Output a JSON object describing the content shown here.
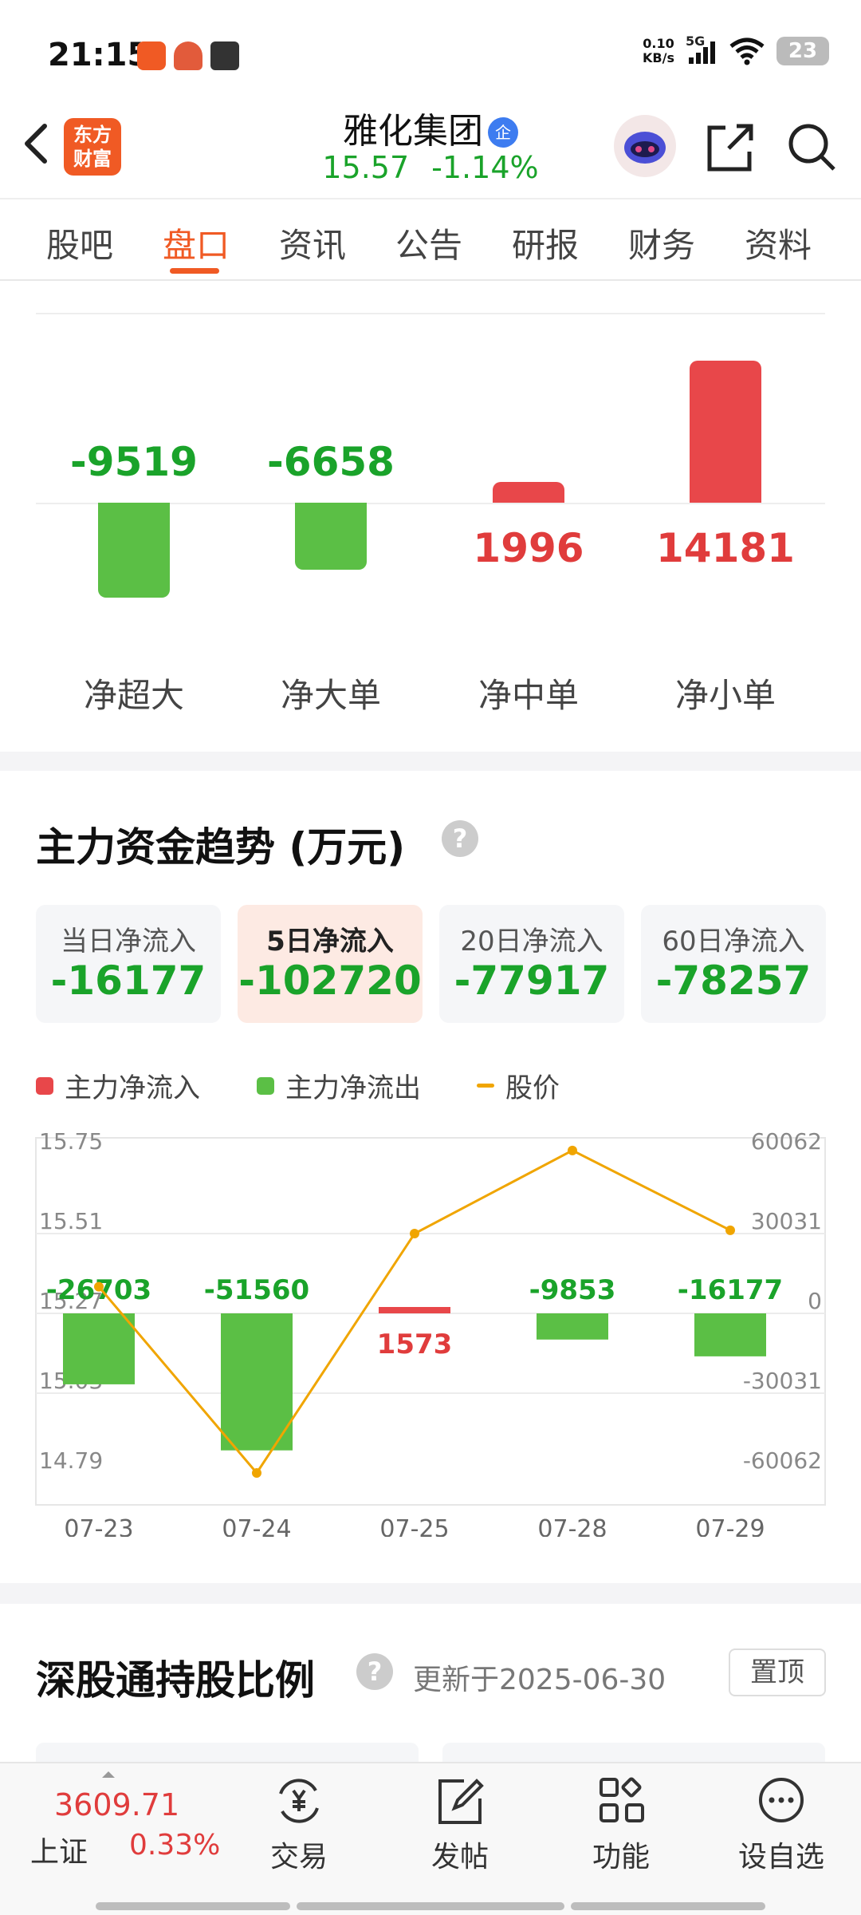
{
  "status_bar": {
    "time": "21:15",
    "net_speed_value": "0.10",
    "net_speed_unit": "KB/s",
    "signal": "5G",
    "battery": "23"
  },
  "header": {
    "logo_line1": "东方",
    "logo_line2": "财富",
    "stock_name": "雅化集团",
    "badge": "企",
    "price": "15.57",
    "change_pct": "-1.14%"
  },
  "tabs": [
    {
      "label": "股吧",
      "active": false
    },
    {
      "label": "盘口",
      "active": true
    },
    {
      "label": "资讯",
      "active": false
    },
    {
      "label": "公告",
      "active": false
    },
    {
      "label": "研报",
      "active": false
    },
    {
      "label": "财务",
      "active": false
    },
    {
      "label": "资料",
      "active": false
    }
  ],
  "order_flow": {
    "items": [
      {
        "label": "净超大",
        "value": -9519,
        "display": "-9519"
      },
      {
        "label": "净大单",
        "value": -6658,
        "display": "-6658"
      },
      {
        "label": "净中单",
        "value": 1996,
        "display": "1996"
      },
      {
        "label": "净小单",
        "value": 14181,
        "display": "14181"
      }
    ]
  },
  "main_fund": {
    "title": "主力资金趋势 (万元)",
    "help": "?",
    "boxes": [
      {
        "label": "当日净流入",
        "value": "-16177",
        "selected": false
      },
      {
        "label": "5日净流入",
        "value": "-102720",
        "selected": true
      },
      {
        "label": "20日净流入",
        "value": "-77917",
        "selected": false
      },
      {
        "label": "60日净流入",
        "value": "-78257",
        "selected": false
      }
    ],
    "legend": {
      "inflow": "主力净流入",
      "outflow": "主力净流出",
      "price": "股价"
    }
  },
  "chart_data": {
    "type": "bar",
    "categories": [
      "07-23",
      "07-24",
      "07-25",
      "07-28",
      "07-29"
    ],
    "series": [
      {
        "name": "主力净流入/流出",
        "values": [
          -26703,
          -51560,
          1573,
          -9853,
          -16177
        ],
        "labels": [
          "-26703",
          "-51560",
          "1573",
          "-9853",
          "-16177"
        ]
      },
      {
        "name": "股价",
        "type": "line",
        "values": [
          15.35,
          14.79,
          15.51,
          15.76,
          15.52
        ]
      }
    ],
    "left_axis_ticks": [
      "15.75",
      "15.51",
      "15.27",
      "15.03",
      "14.79"
    ],
    "left_axis_range": [
      14.79,
      15.75
    ],
    "right_axis_ticks": [
      "60062",
      "30031",
      "0",
      "-30031",
      "-60062"
    ],
    "right_axis_range": [
      -60062,
      60062
    ],
    "colors": {
      "inflow": "#e8474a",
      "outflow": "#5bbf45",
      "price": "#f0a500"
    },
    "grid": true
  },
  "hk_connect": {
    "title": "深股通持股比例",
    "help": "?",
    "updated": "更新于2025-06-30",
    "pin": "置顶"
  },
  "bottom_nav": {
    "index_value": "3609.71",
    "index_name": "上证",
    "index_change": "0.33%",
    "items": [
      {
        "label": "交易",
        "icon": "yen-exchange-icon"
      },
      {
        "label": "发帖",
        "icon": "edit-post-icon"
      },
      {
        "label": "功能",
        "icon": "grid-apps-icon"
      },
      {
        "label": "设自选",
        "icon": "more-dots-icon"
      }
    ]
  }
}
